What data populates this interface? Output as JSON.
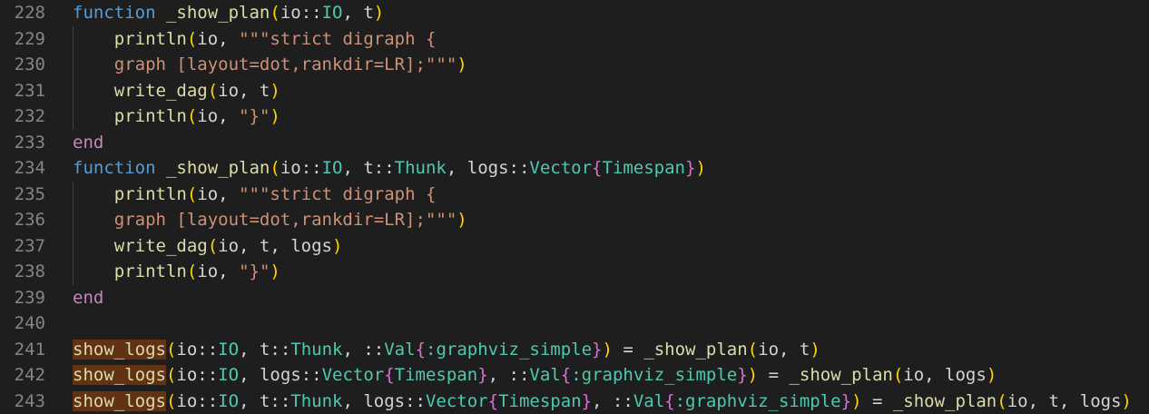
{
  "editor": {
    "line_numbers": [
      "228",
      "229",
      "230",
      "231",
      "232",
      "233",
      "234",
      "235",
      "236",
      "237",
      "238",
      "239",
      "240",
      "241",
      "242",
      "243"
    ],
    "lines": [
      [
        {
          "t": "function",
          "c": "kwf"
        },
        {
          "t": " ",
          "c": "op"
        },
        {
          "t": "_show_plan",
          "c": "fn"
        },
        {
          "t": "(",
          "c": "p1"
        },
        {
          "t": "io::",
          "c": "op"
        },
        {
          "t": "IO",
          "c": "ty"
        },
        {
          "t": ", t",
          "c": "op"
        },
        {
          "t": ")",
          "c": "p1"
        }
      ],
      [
        {
          "t": "    ",
          "c": "op"
        },
        {
          "t": "println",
          "c": "fn"
        },
        {
          "t": "(",
          "c": "p1"
        },
        {
          "t": "io, ",
          "c": "op"
        },
        {
          "t": "\"\"\"strict digraph {",
          "c": "str"
        }
      ],
      [
        {
          "t": "    ",
          "c": "op"
        },
        {
          "t": "graph [layout=dot,rankdir=LR];\"\"\"",
          "c": "str"
        },
        {
          "t": ")",
          "c": "p1"
        }
      ],
      [
        {
          "t": "    ",
          "c": "op"
        },
        {
          "t": "write_dag",
          "c": "fn"
        },
        {
          "t": "(",
          "c": "p1"
        },
        {
          "t": "io, t",
          "c": "op"
        },
        {
          "t": ")",
          "c": "p1"
        }
      ],
      [
        {
          "t": "    ",
          "c": "op"
        },
        {
          "t": "println",
          "c": "fn"
        },
        {
          "t": "(",
          "c": "p1"
        },
        {
          "t": "io, ",
          "c": "op"
        },
        {
          "t": "\"}\"",
          "c": "str"
        },
        {
          "t": ")",
          "c": "p1"
        }
      ],
      [
        {
          "t": "end",
          "c": "kw"
        }
      ],
      [
        {
          "t": "function",
          "c": "kwf"
        },
        {
          "t": " ",
          "c": "op"
        },
        {
          "t": "_show_plan",
          "c": "fn"
        },
        {
          "t": "(",
          "c": "p1"
        },
        {
          "t": "io::",
          "c": "op"
        },
        {
          "t": "IO",
          "c": "ty"
        },
        {
          "t": ", t::",
          "c": "op"
        },
        {
          "t": "Thunk",
          "c": "ty"
        },
        {
          "t": ", logs::",
          "c": "op"
        },
        {
          "t": "Vector",
          "c": "ty"
        },
        {
          "t": "{",
          "c": "p2"
        },
        {
          "t": "Timespan",
          "c": "ty"
        },
        {
          "t": "}",
          "c": "p2"
        },
        {
          "t": ")",
          "c": "p1"
        }
      ],
      [
        {
          "t": "    ",
          "c": "op"
        },
        {
          "t": "println",
          "c": "fn"
        },
        {
          "t": "(",
          "c": "p1"
        },
        {
          "t": "io, ",
          "c": "op"
        },
        {
          "t": "\"\"\"strict digraph {",
          "c": "str"
        }
      ],
      [
        {
          "t": "    ",
          "c": "op"
        },
        {
          "t": "graph [layout=dot,rankdir=LR];\"\"\"",
          "c": "str"
        },
        {
          "t": ")",
          "c": "p1"
        }
      ],
      [
        {
          "t": "    ",
          "c": "op"
        },
        {
          "t": "write_dag",
          "c": "fn"
        },
        {
          "t": "(",
          "c": "p1"
        },
        {
          "t": "io, t, logs",
          "c": "op"
        },
        {
          "t": ")",
          "c": "p1"
        }
      ],
      [
        {
          "t": "    ",
          "c": "op"
        },
        {
          "t": "println",
          "c": "fn"
        },
        {
          "t": "(",
          "c": "p1"
        },
        {
          "t": "io, ",
          "c": "op"
        },
        {
          "t": "\"}\"",
          "c": "str"
        },
        {
          "t": ")",
          "c": "p1"
        }
      ],
      [
        {
          "t": "end",
          "c": "kw"
        }
      ],
      [],
      [
        {
          "t": "show_logs",
          "c": "fn hl"
        },
        {
          "t": "(",
          "c": "p1"
        },
        {
          "t": "io::",
          "c": "op"
        },
        {
          "t": "IO",
          "c": "ty"
        },
        {
          "t": ", t::",
          "c": "op"
        },
        {
          "t": "Thunk",
          "c": "ty"
        },
        {
          "t": ", ::",
          "c": "op"
        },
        {
          "t": "Val",
          "c": "ty"
        },
        {
          "t": "{",
          "c": "p2"
        },
        {
          "t": ":graphviz_simple",
          "c": "ty"
        },
        {
          "t": "}",
          "c": "p2"
        },
        {
          "t": ")",
          "c": "p1"
        },
        {
          "t": " = ",
          "c": "op"
        },
        {
          "t": "_show_plan",
          "c": "fn"
        },
        {
          "t": "(",
          "c": "p1"
        },
        {
          "t": "io, t",
          "c": "op"
        },
        {
          "t": ")",
          "c": "p1"
        }
      ],
      [
        {
          "t": "show_logs",
          "c": "fn hl"
        },
        {
          "t": "(",
          "c": "p1"
        },
        {
          "t": "io::",
          "c": "op"
        },
        {
          "t": "IO",
          "c": "ty"
        },
        {
          "t": ", logs::",
          "c": "op"
        },
        {
          "t": "Vector",
          "c": "ty"
        },
        {
          "t": "{",
          "c": "p2"
        },
        {
          "t": "Timespan",
          "c": "ty"
        },
        {
          "t": "}",
          "c": "p2"
        },
        {
          "t": ", ::",
          "c": "op"
        },
        {
          "t": "Val",
          "c": "ty"
        },
        {
          "t": "{",
          "c": "p2"
        },
        {
          "t": ":graphviz_simple",
          "c": "ty"
        },
        {
          "t": "}",
          "c": "p2"
        },
        {
          "t": ")",
          "c": "p1"
        },
        {
          "t": " = ",
          "c": "op"
        },
        {
          "t": "_show_plan",
          "c": "fn"
        },
        {
          "t": "(",
          "c": "p1"
        },
        {
          "t": "io, logs",
          "c": "op"
        },
        {
          "t": ")",
          "c": "p1"
        }
      ],
      [
        {
          "t": "show_logs",
          "c": "fn hl"
        },
        {
          "t": "(",
          "c": "p1"
        },
        {
          "t": "io::",
          "c": "op"
        },
        {
          "t": "IO",
          "c": "ty"
        },
        {
          "t": ", t::",
          "c": "op"
        },
        {
          "t": "Thunk",
          "c": "ty"
        },
        {
          "t": ", logs::",
          "c": "op"
        },
        {
          "t": "Vector",
          "c": "ty"
        },
        {
          "t": "{",
          "c": "p2"
        },
        {
          "t": "Timespan",
          "c": "ty"
        },
        {
          "t": "}",
          "c": "p2"
        },
        {
          "t": ", ::",
          "c": "op"
        },
        {
          "t": "Val",
          "c": "ty"
        },
        {
          "t": "{",
          "c": "p2"
        },
        {
          "t": ":graphviz_simple",
          "c": "ty"
        },
        {
          "t": "}",
          "c": "p2"
        },
        {
          "t": ")",
          "c": "p1"
        },
        {
          "t": " = ",
          "c": "op"
        },
        {
          "t": "_show_plan",
          "c": "fn"
        },
        {
          "t": "(",
          "c": "p1"
        },
        {
          "t": "io, t, logs",
          "c": "op"
        },
        {
          "t": ")",
          "c": "p1"
        }
      ]
    ]
  },
  "colors": {
    "background": "#1e1e1e",
    "line_number": "#858585",
    "keyword": "#c586c0",
    "function_keyword": "#569cd6",
    "function_name": "#dcdcaa",
    "type": "#4ec9b0",
    "string": "#ce9178",
    "bracket_level1": "#ffd700",
    "bracket_level2": "#da70d6",
    "highlight": "#613214"
  }
}
